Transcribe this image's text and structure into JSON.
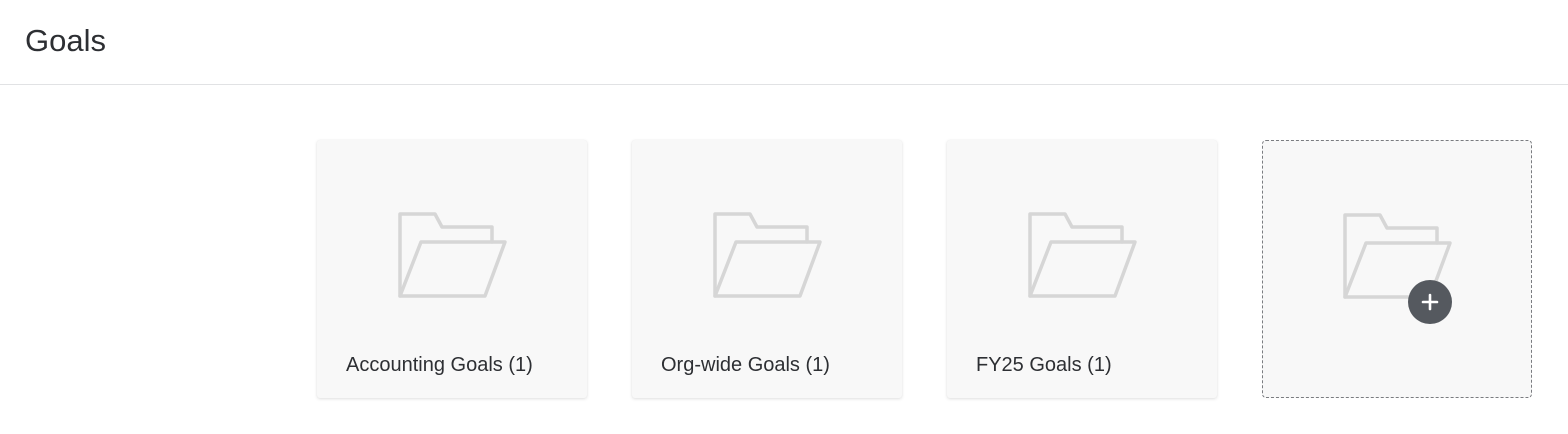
{
  "header": {
    "title": "Goals"
  },
  "folders": [
    {
      "label": "Accounting Goals (1)",
      "icon": "folder-open-icon"
    },
    {
      "label": "Org-wide Goals (1)",
      "icon": "folder-open-icon"
    },
    {
      "label": "FY25 Goals (1)",
      "icon": "folder-open-icon"
    }
  ],
  "add_folder": {
    "icon": "folder-add-icon",
    "badge_icon": "plus-icon"
  },
  "colors": {
    "card_bg": "#f8f8f8",
    "icon_stroke": "#d6d6d6",
    "badge_bg": "#55595f",
    "text": "#2d2f33",
    "divider": "#e1e2e4"
  }
}
